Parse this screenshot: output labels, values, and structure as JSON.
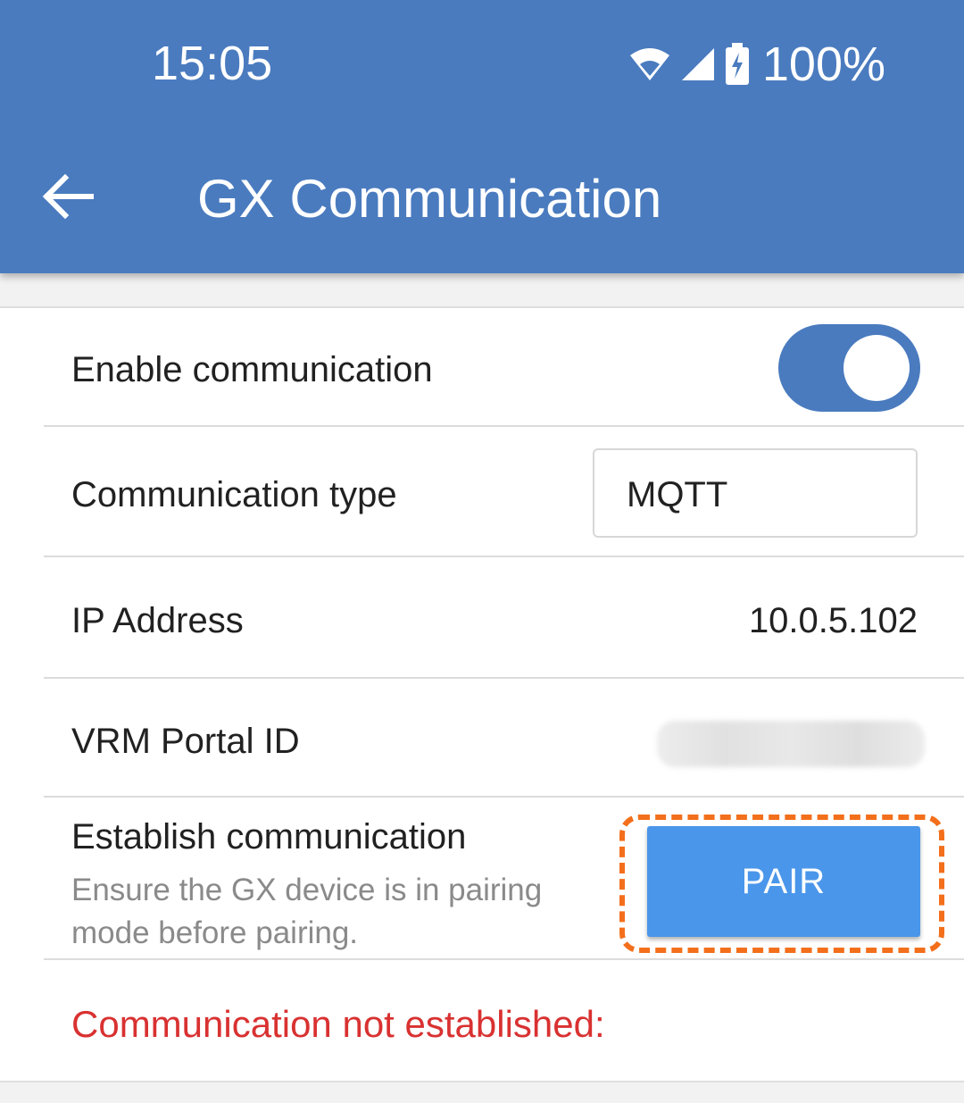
{
  "status_bar": {
    "time": "15:05",
    "battery_percent": "100%",
    "icons": [
      "wifi-icon",
      "cell-signal-icon",
      "battery-charging-icon"
    ]
  },
  "app_bar": {
    "back_icon": "arrow-back-icon",
    "title": "GX Communication"
  },
  "settings": {
    "enable_communication": {
      "label": "Enable communication",
      "enabled": true
    },
    "communication_type": {
      "label": "Communication type",
      "value": "MQTT"
    },
    "ip_address": {
      "label": "IP Address",
      "value": "10.0.5.102"
    },
    "vrm_portal_id": {
      "label": "VRM Portal ID"
    },
    "establish": {
      "label": "Establish communication",
      "hint": "Ensure the GX device is in pairing mode before pairing.",
      "button_label": "PAIR"
    },
    "error_message": "Communication not established:"
  },
  "colors": {
    "accent": "#4a7bbf",
    "button": "#4a96ea",
    "error": "#d93131",
    "highlight": "#f36f1b"
  }
}
